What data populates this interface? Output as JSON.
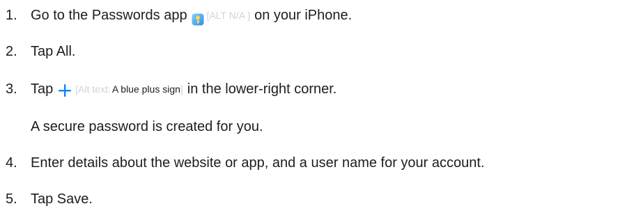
{
  "steps": [
    {
      "number": "1.",
      "text_before": "Go to the Passwords app",
      "icon": "passwords-app-icon",
      "alt_text": "[ALT N/A ]",
      "text_after": "on your iPhone."
    },
    {
      "number": "2.",
      "text": "Tap All."
    },
    {
      "number": "3.",
      "text_before": "Tap",
      "icon": "blue-plus-icon",
      "alt_prefix": "[Alt text:",
      "alt_desc": "A blue plus sign",
      "alt_close": "]",
      "text_after": "in the lower-right corner."
    },
    {
      "note": "A secure password is created for you."
    },
    {
      "number": "4.",
      "text": "Enter details about the website or app, and a user name for your account."
    },
    {
      "number": "5.",
      "text": "Tap Save."
    }
  ],
  "colors": {
    "text": "#1d1d1f",
    "alt_text": "#d2d2d7",
    "accent_blue": "#0a84ff"
  }
}
